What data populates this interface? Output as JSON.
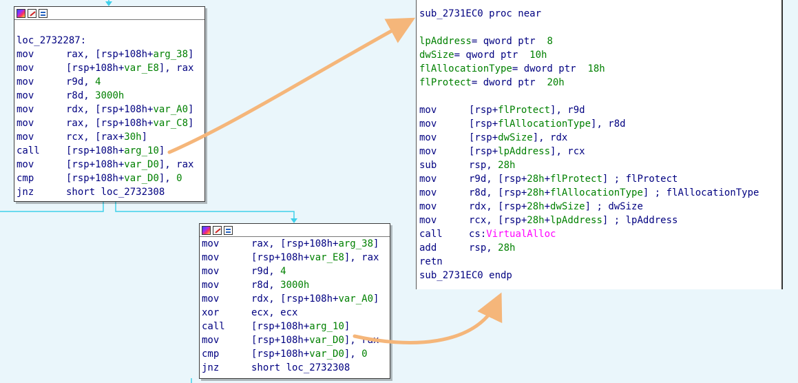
{
  "block_a": {
    "lines": [
      {
        "type": "label",
        "text": "loc_2732287:"
      },
      {
        "type": "ins",
        "mn": "mov",
        "ops": [
          {
            "t": "rax, [rsp+108h+",
            "c": "op"
          },
          {
            "t": "arg_38",
            "c": "nm"
          },
          {
            "t": "]",
            "c": "op"
          }
        ]
      },
      {
        "type": "ins",
        "mn": "mov",
        "ops": [
          {
            "t": "[rsp+108h+",
            "c": "op"
          },
          {
            "t": "var_E8",
            "c": "nm"
          },
          {
            "t": "], rax",
            "c": "op"
          }
        ]
      },
      {
        "type": "ins",
        "mn": "mov",
        "ops": [
          {
            "t": "r9d, ",
            "c": "op"
          },
          {
            "t": "4",
            "c": "nm"
          }
        ]
      },
      {
        "type": "ins",
        "mn": "mov",
        "ops": [
          {
            "t": "r8d, ",
            "c": "op"
          },
          {
            "t": "3000h",
            "c": "nm"
          }
        ]
      },
      {
        "type": "ins",
        "mn": "mov",
        "ops": [
          {
            "t": "rdx, [rsp+108h+",
            "c": "op"
          },
          {
            "t": "var_A0",
            "c": "nm"
          },
          {
            "t": "]",
            "c": "op"
          }
        ]
      },
      {
        "type": "ins",
        "mn": "mov",
        "ops": [
          {
            "t": "rax, [rsp+108h+",
            "c": "op"
          },
          {
            "t": "var_C8",
            "c": "nm"
          },
          {
            "t": "]",
            "c": "op"
          }
        ]
      },
      {
        "type": "ins",
        "mn": "mov",
        "ops": [
          {
            "t": "rcx, [rax+",
            "c": "op"
          },
          {
            "t": "30h",
            "c": "nm"
          },
          {
            "t": "]",
            "c": "op"
          }
        ]
      },
      {
        "type": "ins",
        "mn": "call",
        "ops": [
          {
            "t": "[rsp+108h+",
            "c": "op"
          },
          {
            "t": "arg_10",
            "c": "nm"
          },
          {
            "t": "]",
            "c": "op"
          }
        ]
      },
      {
        "type": "ins",
        "mn": "mov",
        "ops": [
          {
            "t": "[rsp+108h+",
            "c": "op"
          },
          {
            "t": "var_D0",
            "c": "nm"
          },
          {
            "t": "], rax",
            "c": "op"
          }
        ]
      },
      {
        "type": "ins",
        "mn": "cmp",
        "ops": [
          {
            "t": "[rsp+108h+",
            "c": "op"
          },
          {
            "t": "var_D0",
            "c": "nm"
          },
          {
            "t": "], ",
            "c": "op"
          },
          {
            "t": "0",
            "c": "nm"
          }
        ]
      },
      {
        "type": "ins",
        "mn": "jnz",
        "ops": [
          {
            "t": "short loc_2732308",
            "c": "op"
          }
        ]
      }
    ]
  },
  "block_b": {
    "lines": [
      {
        "type": "ins",
        "mn": "mov",
        "ops": [
          {
            "t": "rax, [rsp+108h+",
            "c": "op"
          },
          {
            "t": "arg_38",
            "c": "nm"
          },
          {
            "t": "]",
            "c": "op"
          }
        ]
      },
      {
        "type": "ins",
        "mn": "mov",
        "ops": [
          {
            "t": "[rsp+108h+",
            "c": "op"
          },
          {
            "t": "var_E8",
            "c": "nm"
          },
          {
            "t": "], rax",
            "c": "op"
          }
        ]
      },
      {
        "type": "ins",
        "mn": "mov",
        "ops": [
          {
            "t": "r9d, ",
            "c": "op"
          },
          {
            "t": "4",
            "c": "nm"
          }
        ]
      },
      {
        "type": "ins",
        "mn": "mov",
        "ops": [
          {
            "t": "r8d, ",
            "c": "op"
          },
          {
            "t": "3000h",
            "c": "nm"
          }
        ]
      },
      {
        "type": "ins",
        "mn": "mov",
        "ops": [
          {
            "t": "rdx, [rsp+108h+",
            "c": "op"
          },
          {
            "t": "var_A0",
            "c": "nm"
          },
          {
            "t": "]",
            "c": "op"
          }
        ]
      },
      {
        "type": "ins",
        "mn": "xor",
        "ops": [
          {
            "t": "ecx, ecx",
            "c": "op"
          }
        ]
      },
      {
        "type": "ins",
        "mn": "call",
        "ops": [
          {
            "t": "[rsp+108h+",
            "c": "op"
          },
          {
            "t": "arg_10",
            "c": "nm"
          },
          {
            "t": "]",
            "c": "op"
          }
        ]
      },
      {
        "type": "ins",
        "mn": "mov",
        "ops": [
          {
            "t": "[rsp+108h+",
            "c": "op"
          },
          {
            "t": "var_D0",
            "c": "nm"
          },
          {
            "t": "], rax",
            "c": "op"
          }
        ]
      },
      {
        "type": "ins",
        "mn": "cmp",
        "ops": [
          {
            "t": "[rsp+108h+",
            "c": "op"
          },
          {
            "t": "var_D0",
            "c": "nm"
          },
          {
            "t": "], ",
            "c": "op"
          },
          {
            "t": "0",
            "c": "nm"
          }
        ]
      },
      {
        "type": "ins",
        "mn": "jnz",
        "ops": [
          {
            "t": "short loc_2732308",
            "c": "op"
          }
        ]
      }
    ]
  },
  "block_c": {
    "lines": [
      {
        "type": "raw",
        "parts": [
          {
            "t": "sub_2731EC0 proc near",
            "c": "op"
          }
        ]
      },
      {
        "type": "blank"
      },
      {
        "type": "raw",
        "parts": [
          {
            "t": "lpAddress",
            "c": "nm"
          },
          {
            "t": "= qword ptr  ",
            "c": "op"
          },
          {
            "t": "8",
            "c": "nm"
          }
        ]
      },
      {
        "type": "raw",
        "parts": [
          {
            "t": "dwSize",
            "c": "nm"
          },
          {
            "t": "= qword ptr  ",
            "c": "op"
          },
          {
            "t": "10h",
            "c": "nm"
          }
        ]
      },
      {
        "type": "raw",
        "parts": [
          {
            "t": "flAllocationType",
            "c": "nm"
          },
          {
            "t": "= dword ptr  ",
            "c": "op"
          },
          {
            "t": "18h",
            "c": "nm"
          }
        ]
      },
      {
        "type": "raw",
        "parts": [
          {
            "t": "flProtect",
            "c": "nm"
          },
          {
            "t": "= dword ptr  ",
            "c": "op"
          },
          {
            "t": "20h",
            "c": "nm"
          }
        ]
      },
      {
        "type": "blank"
      },
      {
        "type": "ins",
        "mn": "mov",
        "ops": [
          {
            "t": "[rsp+",
            "c": "op"
          },
          {
            "t": "flProtect",
            "c": "nm"
          },
          {
            "t": "], r9d",
            "c": "op"
          }
        ]
      },
      {
        "type": "ins",
        "mn": "mov",
        "ops": [
          {
            "t": "[rsp+",
            "c": "op"
          },
          {
            "t": "flAllocationType",
            "c": "nm"
          },
          {
            "t": "], r8d",
            "c": "op"
          }
        ]
      },
      {
        "type": "ins",
        "mn": "mov",
        "ops": [
          {
            "t": "[rsp+",
            "c": "op"
          },
          {
            "t": "dwSize",
            "c": "nm"
          },
          {
            "t": "], rdx",
            "c": "op"
          }
        ]
      },
      {
        "type": "ins",
        "mn": "mov",
        "ops": [
          {
            "t": "[rsp+",
            "c": "op"
          },
          {
            "t": "lpAddress",
            "c": "nm"
          },
          {
            "t": "], rcx",
            "c": "op"
          }
        ]
      },
      {
        "type": "ins",
        "mn": "sub",
        "ops": [
          {
            "t": "rsp, ",
            "c": "op"
          },
          {
            "t": "28h",
            "c": "nm"
          }
        ]
      },
      {
        "type": "ins",
        "mn": "mov",
        "ops": [
          {
            "t": "r9d, [rsp+",
            "c": "op"
          },
          {
            "t": "28h",
            "c": "nm"
          },
          {
            "t": "+",
            "c": "op"
          },
          {
            "t": "flProtect",
            "c": "nm"
          },
          {
            "t": "] ; flProtect",
            "c": "op"
          }
        ]
      },
      {
        "type": "ins",
        "mn": "mov",
        "ops": [
          {
            "t": "r8d, [rsp+",
            "c": "op"
          },
          {
            "t": "28h",
            "c": "nm"
          },
          {
            "t": "+",
            "c": "op"
          },
          {
            "t": "flAllocationType",
            "c": "nm"
          },
          {
            "t": "] ; flAllocationType",
            "c": "op"
          }
        ]
      },
      {
        "type": "ins",
        "mn": "mov",
        "ops": [
          {
            "t": "rdx, [rsp+",
            "c": "op"
          },
          {
            "t": "28h",
            "c": "nm"
          },
          {
            "t": "+",
            "c": "op"
          },
          {
            "t": "dwSize",
            "c": "nm"
          },
          {
            "t": "] ; dwSize",
            "c": "op"
          }
        ]
      },
      {
        "type": "ins",
        "mn": "mov",
        "ops": [
          {
            "t": "rcx, [rsp+",
            "c": "op"
          },
          {
            "t": "28h",
            "c": "nm"
          },
          {
            "t": "+",
            "c": "op"
          },
          {
            "t": "lpAddress",
            "c": "nm"
          },
          {
            "t": "] ; lpAddress",
            "c": "op"
          }
        ]
      },
      {
        "type": "ins",
        "mn": "call",
        "ops": [
          {
            "t": "cs:",
            "c": "op"
          },
          {
            "t": "VirtualAlloc",
            "c": "imp"
          }
        ]
      },
      {
        "type": "ins",
        "mn": "add",
        "ops": [
          {
            "t": "rsp, ",
            "c": "op"
          },
          {
            "t": "28h",
            "c": "nm"
          }
        ]
      },
      {
        "type": "ins",
        "mn": "retn",
        "ops": []
      },
      {
        "type": "raw",
        "parts": [
          {
            "t": "sub_2731EC0 endp",
            "c": "op"
          }
        ]
      }
    ]
  },
  "colors": {
    "background": "#eaf6fb",
    "edge": "#3fd0ea",
    "arrow": "#f5b67a",
    "mnemonic": "#000080",
    "number": "#008000",
    "import": "#ff00ff"
  },
  "icons": [
    "graph-icon",
    "edit-icon",
    "grid-icon"
  ]
}
